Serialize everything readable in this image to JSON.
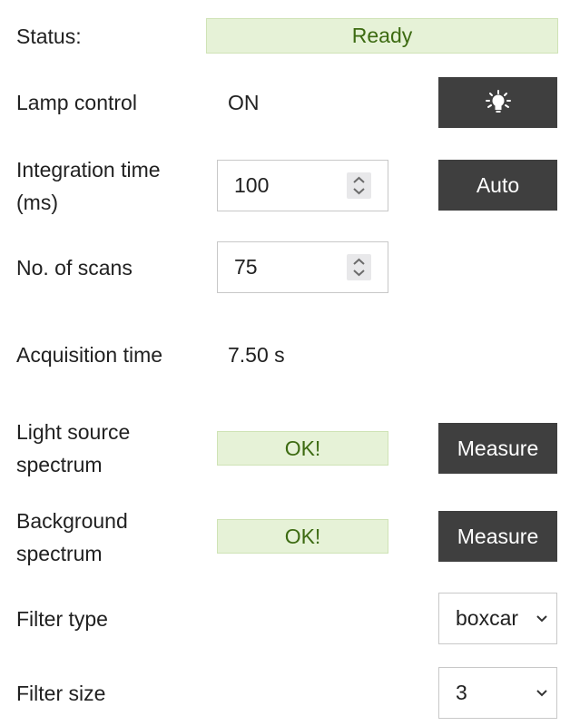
{
  "status": {
    "label": "Status:",
    "value": "Ready"
  },
  "lamp": {
    "label": "Lamp control",
    "value": "ON",
    "button_icon": "lightbulb-icon"
  },
  "integration": {
    "label_line1": "Integration time",
    "label_line2": "(ms)",
    "value": "100",
    "button_label": "Auto"
  },
  "scans": {
    "label": "No. of scans",
    "value": "75"
  },
  "acquisition": {
    "label": "Acquisition time",
    "value": "7.50 s"
  },
  "light_source": {
    "label_line1": "Light source",
    "label_line2": "spectrum",
    "status": "OK!",
    "button_label": "Measure"
  },
  "background": {
    "label_line1": "Background",
    "label_line2": "spectrum",
    "status": "OK!",
    "button_label": "Measure"
  },
  "filter_type": {
    "label": "Filter type",
    "selected": "boxcar"
  },
  "filter_size": {
    "label": "Filter size",
    "selected": "3"
  },
  "colors": {
    "ok_bg": "#e6f2d7",
    "ok_text": "#3d6b12",
    "button_bg": "#3f3f3f"
  }
}
